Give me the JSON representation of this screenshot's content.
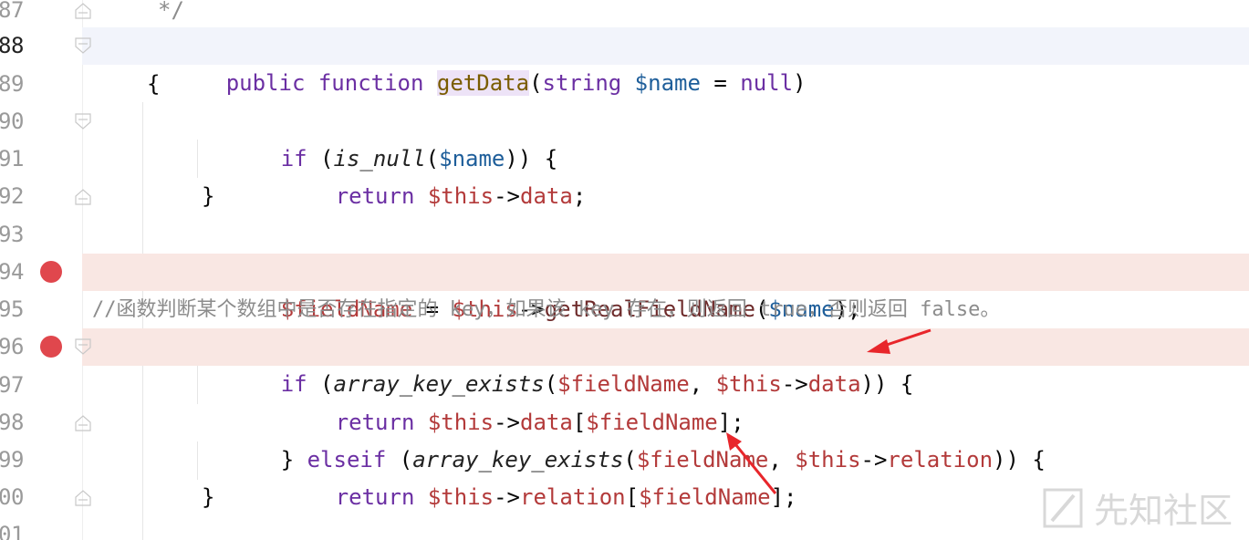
{
  "editor": {
    "lines": [
      {
        "num": "87",
        "text": "*/"
      },
      {
        "num": "88",
        "keyword1": "public",
        "keyword2": "function",
        "name": "getData",
        "params_open": "(",
        "param_type": "string",
        "param_var": "$name",
        "param_eq": " = ",
        "param_default": "null",
        "params_close": ")"
      },
      {
        "num": "89",
        "text": "{"
      },
      {
        "num": "90",
        "kw": "if",
        "open": " (",
        "fn": "is_null",
        "p1": "(",
        "var": "$name",
        "close": ")) {"
      },
      {
        "num": "91",
        "kw": "return",
        "this": "$this",
        "arrow": "->",
        "prop": "data",
        "end": ";"
      },
      {
        "num": "92",
        "text": "}"
      },
      {
        "num": "93"
      },
      {
        "num": "94",
        "var": "$fieldName",
        "eq": " = ",
        "this": "$this",
        "arrow": "->",
        "fn": "getRealFieldName",
        "open": "(",
        "arg": "$name",
        "close": ");"
      },
      {
        "num": "95",
        "comment": "//函数判断某个数组中是否存在指定的 key，如果该 key 存在，则返回 true，否则返回 false。"
      },
      {
        "num": "96",
        "kw": "if",
        "open": " (",
        "fn": "array_key_exists",
        "p1": "(",
        "var": "$fieldName",
        "comma": ", ",
        "this": "$this",
        "arrow": "->",
        "prop": "data",
        "close": ")) {"
      },
      {
        "num": "97",
        "kw": "return",
        "this": "$this",
        "arrow": "->",
        "prop": "data",
        "lb": "[",
        "var": "$fieldName",
        "rb": "];"
      },
      {
        "num": "98",
        "brace": "}",
        "kw": " elseif",
        "open": " (",
        "fn": "array_key_exists",
        "p1": "(",
        "var": "$fieldName",
        "comma": ", ",
        "this": "$this",
        "arrow": "->",
        "prop": "relation",
        "close": ")) {"
      },
      {
        "num": "99",
        "kw": "return",
        "this": "$this",
        "arrow": "->",
        "prop": "relation",
        "lb": "[",
        "var": "$fieldName",
        "rb": "];"
      },
      {
        "num": "00",
        "text": "}"
      },
      {
        "num": "01"
      }
    ]
  },
  "watermark": {
    "text": "先知社区"
  },
  "colors": {
    "breakpoint": "#e0474d",
    "breakpoint_line_bg": "#f9e7e3",
    "current_line_bg": "#f2f4fb",
    "annotation_arrow": "#e8262b"
  },
  "icons": [
    "breakpoint-icon",
    "fold-icon",
    "arrow-annotation-icon"
  ]
}
